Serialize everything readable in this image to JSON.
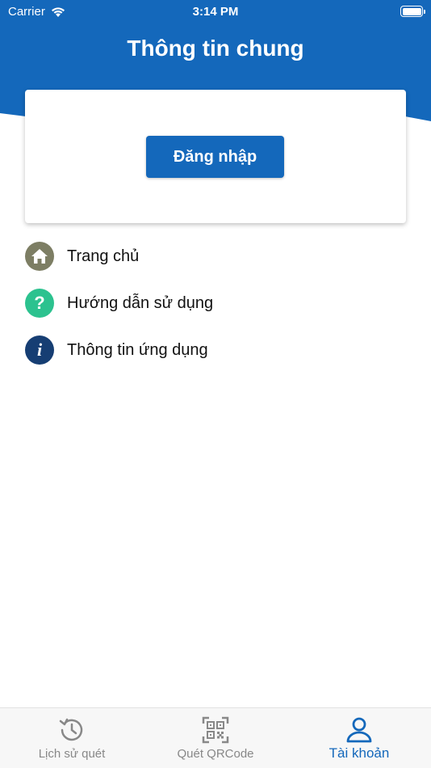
{
  "status_bar": {
    "carrier": "Carrier",
    "time": "3:14 PM"
  },
  "header": {
    "title": "Thông tin chung"
  },
  "card": {
    "login_label": "Đăng nhập"
  },
  "menu": [
    {
      "label": "Trang chủ",
      "icon": "home-icon",
      "color": "#7d7e64"
    },
    {
      "label": "Hướng dẫn sử dụng",
      "icon": "help-icon",
      "glyph": "?",
      "color": "#2cc28f"
    },
    {
      "label": "Thông tin ứng dụng",
      "icon": "info-icon",
      "glyph": "i",
      "color": "#163e73"
    }
  ],
  "tab_bar": {
    "tabs": [
      {
        "label": "Lịch sử quét",
        "icon": "history-icon"
      },
      {
        "label": "Quét QRCode",
        "icon": "qr-code-icon"
      },
      {
        "label": "Tài khoản",
        "icon": "account-icon",
        "active": true
      }
    ]
  },
  "colors": {
    "primary": "#1468bb",
    "inactive": "#888888"
  }
}
